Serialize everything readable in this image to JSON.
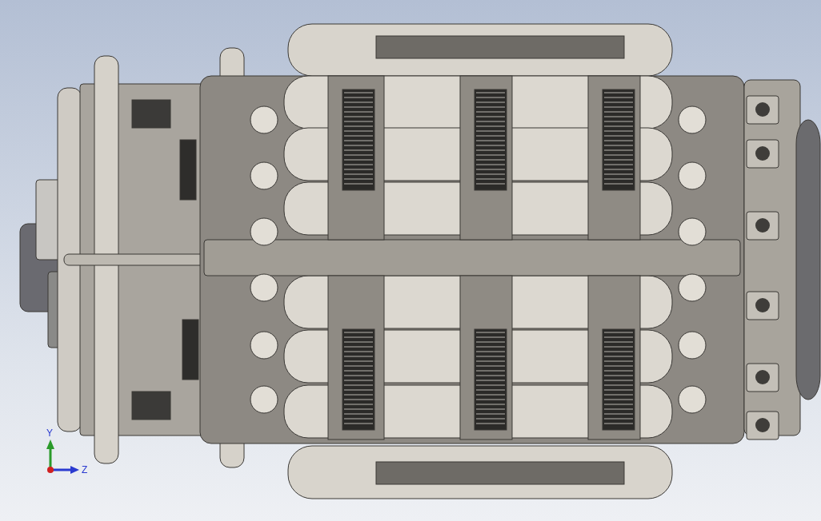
{
  "viewport": {
    "triad": {
      "axes": [
        {
          "label": "Y",
          "kind": "y",
          "color": "#2a9a2a"
        },
        {
          "label": "Z",
          "kind": "z",
          "color": "#2a3ad0"
        }
      ]
    }
  }
}
